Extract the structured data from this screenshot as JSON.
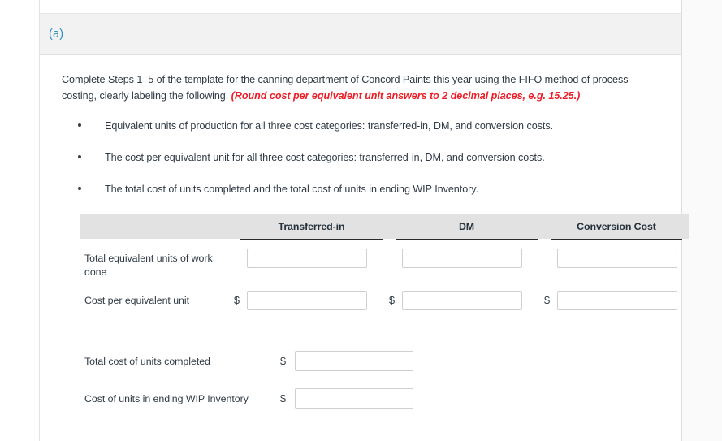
{
  "card": {
    "part_label": "(a)",
    "instruction_main": "Complete Steps 1–5 of the template for the canning department of Concord Paints this year using the FIFO method of process costing, clearly labeling the following. ",
    "instruction_note": "(Round cost per equivalent unit answers to 2 decimal places, e.g. 15.25.)",
    "bullets": [
      "Equivalent units of production for all three cost categories: transferred-in, DM, and conversion costs.",
      "The cost per equivalent unit for all three cost categories: transferred-in, DM, and conversion costs.",
      "The total cost of units completed and the total cost of units in ending WIP Inventory."
    ]
  },
  "table": {
    "columns": [
      {
        "label": "Transferred-in"
      },
      {
        "label": "DM"
      },
      {
        "label": "Conversion Cost"
      }
    ],
    "rows": [
      {
        "label": "Total equivalent units of work done",
        "currency_prefix": "",
        "values": [
          "",
          "",
          ""
        ],
        "placeholders": [
          "",
          "",
          ""
        ]
      },
      {
        "label": "Cost per equivalent unit",
        "currency_prefix": "$",
        "values": [
          "",
          "",
          ""
        ],
        "placeholders": [
          "",
          "",
          ""
        ]
      }
    ]
  },
  "summary": {
    "rows": [
      {
        "label": "Total cost of units completed",
        "currency_prefix": "$",
        "value": "",
        "placeholder": ""
      },
      {
        "label": "Cost of units in ending WIP Inventory",
        "currency_prefix": "$",
        "value": "",
        "placeholder": ""
      }
    ]
  },
  "colors": {
    "part_label": "#2b8cbe",
    "note_red": "#ee1c25",
    "header_band": "#e2e2e2",
    "card_header": "#f2f2f2",
    "text": "#2f3a45"
  }
}
